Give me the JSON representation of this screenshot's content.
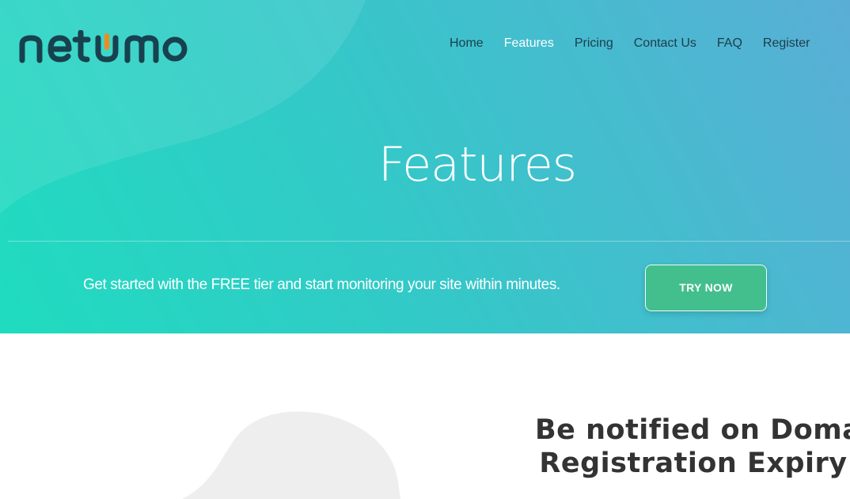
{
  "brand": {
    "logo_text": "netumo",
    "accent_color": "#f08a1e",
    "logo_color": "#17414f"
  },
  "nav": {
    "items": [
      {
        "label": "Home",
        "active": false
      },
      {
        "label": "Features",
        "active": true
      },
      {
        "label": "Pricing",
        "active": false
      },
      {
        "label": "Contact Us",
        "active": false
      },
      {
        "label": "FAQ",
        "active": false
      },
      {
        "label": "Register",
        "active": false
      }
    ]
  },
  "hero": {
    "title": "Features",
    "cta_text": "Get started with the FREE tier and start monitoring your site within minutes.",
    "cta_button": "TRY NOW",
    "button_color": "#43bf8e"
  },
  "section": {
    "heading_line1": "Be notified on Domain",
    "heading_line2": "Registration Expiry"
  }
}
